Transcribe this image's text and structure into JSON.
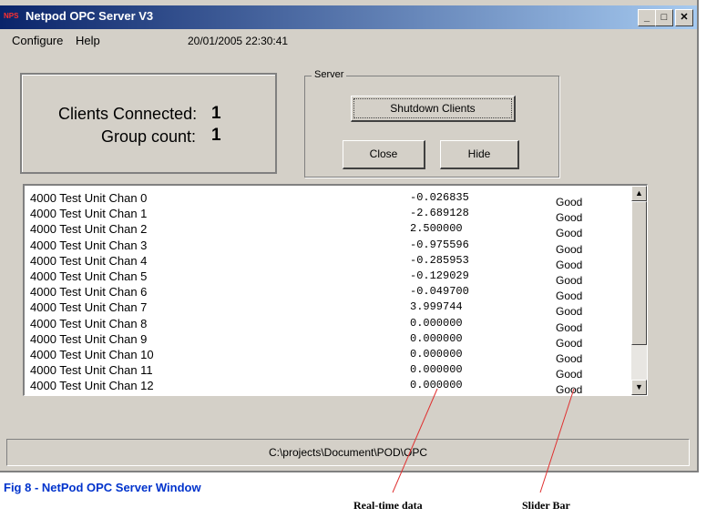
{
  "window": {
    "title": "Netpod OPC Server V3",
    "app_icon_text": "NPS"
  },
  "title_buttons": {
    "minimize": "_",
    "maximize": "□",
    "close": "✕"
  },
  "menu": [
    "Configure",
    "Help"
  ],
  "datetime": "20/01/2005 22:30:41",
  "stats": {
    "clients_label": "Clients Connected:",
    "clients_value": "1",
    "groups_label": "Group count:",
    "groups_value": "1"
  },
  "server": {
    "group_label": "Server",
    "shutdown_label": "Shutdown Clients",
    "close_label": "Close",
    "hide_label": "Hide"
  },
  "channels": [
    {
      "name": "4000 Test Unit Chan 0",
      "value": "-0.026835",
      "status": "Good"
    },
    {
      "name": "4000 Test Unit Chan 1",
      "value": "-2.689128",
      "status": "Good"
    },
    {
      "name": "4000 Test Unit Chan 2",
      "value": "2.500000",
      "status": "Good"
    },
    {
      "name": "4000 Test Unit Chan 3",
      "value": "-0.975596",
      "status": "Good"
    },
    {
      "name": "4000 Test Unit Chan 4",
      "value": "-0.285953",
      "status": "Good"
    },
    {
      "name": "4000 Test Unit Chan 5",
      "value": "-0.129029",
      "status": "Good"
    },
    {
      "name": "4000 Test Unit Chan 6",
      "value": "-0.049700",
      "status": "Good"
    },
    {
      "name": "4000 Test Unit Chan 7",
      "value": "3.999744",
      "status": "Good"
    },
    {
      "name": "4000 Test Unit Chan 8",
      "value": "0.000000",
      "status": "Good"
    },
    {
      "name": "4000 Test Unit Chan 9",
      "value": "0.000000",
      "status": "Good"
    },
    {
      "name": "4000 Test Unit Chan 10",
      "value": "0.000000",
      "status": "Good"
    },
    {
      "name": "4000 Test Unit Chan 11",
      "value": "0.000000",
      "status": "Good"
    },
    {
      "name": "4000 Test Unit Chan 12",
      "value": "0.000000",
      "status": "Good"
    }
  ],
  "scroll": {
    "up": "▲",
    "down": "▼"
  },
  "status_path": "C:\\projects\\Document\\POD\\OPC",
  "caption": "Fig 8 - NetPod OPC Server Window",
  "annotations": {
    "realtime": "Real-time data",
    "slider": "Slider Bar"
  },
  "colors": {
    "titlebar_start": "#0a246a",
    "titlebar_end": "#a6caf0",
    "caption": "#0033cc",
    "leader": "#e03030",
    "face": "#d4d0c8"
  },
  "icons": [
    "app-icon",
    "minimize-icon",
    "maximize-icon",
    "close-icon",
    "scroll-up-icon",
    "scroll-down-icon"
  ]
}
